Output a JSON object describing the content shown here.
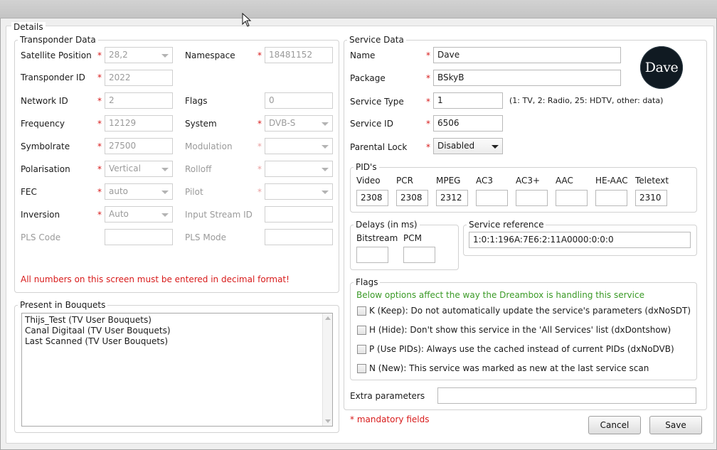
{
  "details_title": "Details",
  "transponder": {
    "title": "Transponder Data",
    "satellite_position": {
      "label": "Satellite Position",
      "value": "28,2"
    },
    "namespace": {
      "label": "Namespace",
      "value": "18481152"
    },
    "transponder_id": {
      "label": "Transponder ID",
      "value": "2022"
    },
    "network_id": {
      "label": "Network ID",
      "value": "2"
    },
    "flags": {
      "label": "Flags",
      "value": "0"
    },
    "frequency": {
      "label": "Frequency",
      "value": "12129"
    },
    "system": {
      "label": "System",
      "value": "DVB-S"
    },
    "symbolrate": {
      "label": "Symbolrate",
      "value": "27500"
    },
    "modulation": {
      "label": "Modulation",
      "value": ""
    },
    "polarisation": {
      "label": "Polarisation",
      "value": "Vertical"
    },
    "rolloff": {
      "label": "Rolloff",
      "value": ""
    },
    "fec": {
      "label": "FEC",
      "value": "auto"
    },
    "pilot": {
      "label": "Pilot",
      "value": ""
    },
    "inversion": {
      "label": "Inversion",
      "value": "Auto"
    },
    "input_stream_id": {
      "label": "Input Stream ID",
      "value": ""
    },
    "pls_code": {
      "label": "PLS Code",
      "value": ""
    },
    "pls_mode": {
      "label": "PLS Mode",
      "value": ""
    },
    "warning": "All numbers on this screen must be entered in decimal format!"
  },
  "bouquets": {
    "title": "Present in Bouquets",
    "items": [
      "Thijs_Test (TV User Bouquets)",
      "Canal Digitaal (TV User Bouquets)",
      "Last Scanned (TV User Bouquets)"
    ]
  },
  "service": {
    "title": "Service Data",
    "name": {
      "label": "Name",
      "value": "Dave"
    },
    "package": {
      "label": "Package",
      "value": "BSkyB"
    },
    "service_type": {
      "label": "Service Type",
      "value": "1",
      "hint": "(1: TV, 2: Radio, 25: HDTV, other: data)"
    },
    "service_id": {
      "label": "Service ID",
      "value": "6506"
    },
    "parental_lock": {
      "label": "Parental Lock",
      "value": "Disabled"
    },
    "logo_text": "Dave",
    "required_marker": "*"
  },
  "pids": {
    "title": "PID's",
    "columns": [
      {
        "label": "Video",
        "value": "2308"
      },
      {
        "label": "PCR",
        "value": "2308"
      },
      {
        "label": "MPEG",
        "value": "2312"
      },
      {
        "label": "AC3",
        "value": ""
      },
      {
        "label": "AC3+",
        "value": ""
      },
      {
        "label": "AAC",
        "value": ""
      },
      {
        "label": "HE-AAC",
        "value": ""
      },
      {
        "label": "Teletext",
        "value": "2310"
      }
    ]
  },
  "delays": {
    "title": "Delays (in ms)",
    "bitstream": {
      "label": "Bitstream",
      "value": ""
    },
    "pcm": {
      "label": "PCM",
      "value": ""
    }
  },
  "service_reference": {
    "title": "Service reference",
    "value": "1:0:1:196A:7E6:2:11A0000:0:0:0"
  },
  "flags_group": {
    "title": "Flags",
    "note": "Below options affect the way the Dreambox is handling this service",
    "options": [
      {
        "label": "K (Keep): Do not automatically update the service's parameters (dxNoSDT)",
        "checked": false
      },
      {
        "label": "H (Hide): Don't show this service in the 'All Services' list (dxDontshow)",
        "checked": false
      },
      {
        "label": "P (Use PIDs): Always use the cached instead of current PIDs (dxNoDVB)",
        "checked": false
      },
      {
        "label": "N (New): This service was marked as new at the last service scan",
        "checked": false
      }
    ]
  },
  "extra_parameters": {
    "label": "Extra parameters",
    "value": ""
  },
  "mandatory_note": "* mandatory fields",
  "buttons": {
    "cancel": "Cancel",
    "save": "Save"
  }
}
